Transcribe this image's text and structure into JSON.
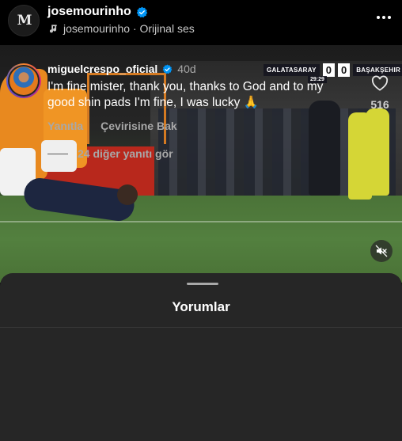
{
  "header": {
    "avatar_text": "M",
    "username": "josemourinho",
    "verified_icon": "verified-badge-icon",
    "audio_label": "josemourinho · Orijinal ses",
    "more_icon": "more-horizontal-icon"
  },
  "video": {
    "scoreboard": {
      "home_team": "GALATASARAY",
      "home_score": "0",
      "away_score": "0",
      "away_team": "BAŞAKŞEHIR",
      "clock": "29:29"
    },
    "mute_icon": "speaker-muted-icon"
  },
  "comments": {
    "title": "Yorumlar",
    "items": [
      {
        "username": "miguelcrespo_oficial",
        "verified": true,
        "age": "40d",
        "text": "I'm fine mister, thank you, thanks to God and to my good shin pads I'm fine, I was lucky 🙏",
        "reply_label": "Yanıtla",
        "translate_label": "Çevirisine Bak",
        "like_count": "516",
        "more_replies_label": "24 diğer yanıtı gör"
      }
    ]
  },
  "colors": {
    "background": "#000000",
    "sheet": "#262626",
    "verified_blue": "#0095f6",
    "secondary_text": "#a8a8a8"
  }
}
